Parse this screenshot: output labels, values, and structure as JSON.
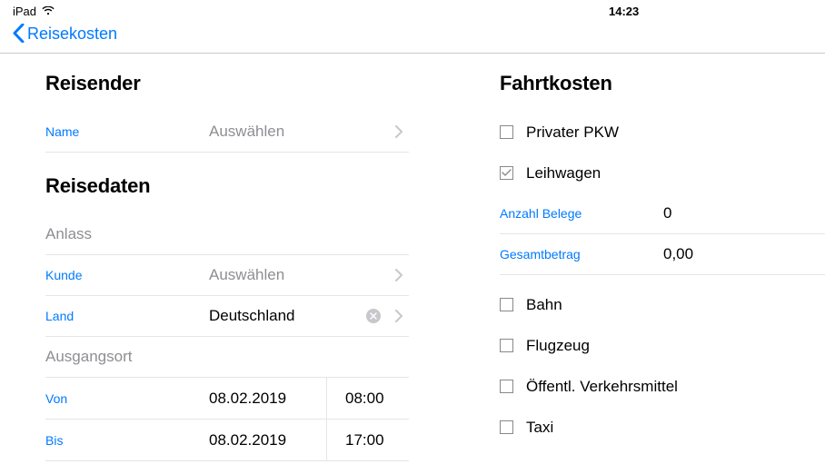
{
  "status": {
    "device": "iPad",
    "time": "14:23"
  },
  "nav": {
    "back_label": "Reisekosten"
  },
  "left": {
    "section_reisender": "Reisender",
    "name_label": "Name",
    "name_placeholder": "Auswählen",
    "section_reisedaten": "Reisedaten",
    "anlass_label": "Anlass",
    "kunde_label": "Kunde",
    "kunde_placeholder": "Auswählen",
    "land_label": "Land",
    "land_value": "Deutschland",
    "ausgangsort_label": "Ausgangsort",
    "von_label": "Von",
    "von_date": "08.02.2019",
    "von_time": "08:00",
    "bis_label": "Bis",
    "bis_date": "08.02.2019",
    "bis_time": "17:00"
  },
  "right": {
    "section": "Fahrtkosten",
    "pkw": {
      "label": "Privater PKW",
      "checked": false
    },
    "leihwagen": {
      "label": "Leihwagen",
      "checked": true
    },
    "belege_label": "Anzahl Belege",
    "belege_value": "0",
    "betrag_label": "Gesamtbetrag",
    "betrag_value": "0,00",
    "bahn": {
      "label": "Bahn",
      "checked": false
    },
    "flugzeug": {
      "label": "Flugzeug",
      "checked": false
    },
    "opnv": {
      "label": "Öffentl. Verkehrsmittel",
      "checked": false
    },
    "taxi": {
      "label": "Taxi",
      "checked": false
    }
  }
}
